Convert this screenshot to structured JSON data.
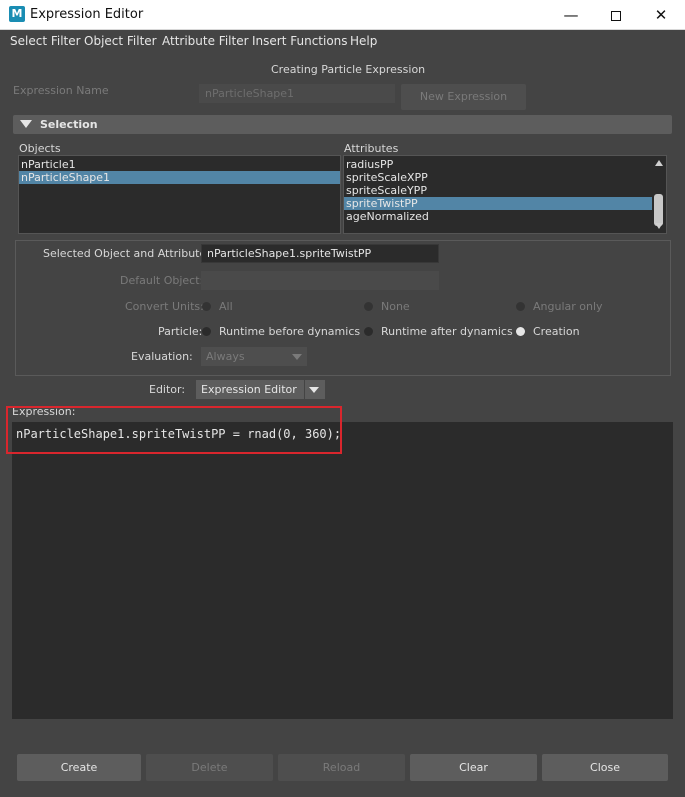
{
  "window": {
    "title": "Expression Editor",
    "icon_letter": "M",
    "controls": {
      "minimize": "—",
      "close": "✕"
    }
  },
  "menu": [
    "Select Filter",
    "Object Filter",
    "Attribute Filter",
    "Insert Functions",
    "Help"
  ],
  "header": {
    "mode": "Creating Particle Expression",
    "name_label": "Expression Name",
    "name_value": "nParticleShape1",
    "new_expression": "New Expression"
  },
  "selection": {
    "title": "Selection",
    "objects_label": "Objects",
    "attributes_label": "Attributes",
    "objects": [
      "nParticle1",
      "nParticleShape1"
    ],
    "objects_selected_index": 1,
    "attributes": [
      "radiusPP",
      "spriteScaleXPP",
      "spriteScaleYPP",
      "spriteTwistPP",
      "ageNormalized"
    ],
    "attributes_selected_index": 3
  },
  "options": {
    "selected_label": "Selected Object and Attribute:",
    "selected_value": "nParticleShape1.spriteTwistPP",
    "default_label": "Default Object:",
    "convert_label": "Convert Units:",
    "convert_options": [
      "All",
      "None",
      "Angular only"
    ],
    "particle_label": "Particle:",
    "particle_options": [
      "Runtime before dynamics",
      "Runtime after dynamics",
      "Creation"
    ],
    "particle_selected_index": 2,
    "evaluation_label": "Evaluation:",
    "evaluation_value": "Always",
    "editor_label": "Editor:",
    "editor_value": "Expression Editor"
  },
  "expression": {
    "label": "Expression:",
    "code": "nParticleShape1.spriteTwistPP = rnad(0, 360);"
  },
  "buttons": {
    "create": "Create",
    "delete": "Delete",
    "reload": "Reload",
    "clear": "Clear",
    "close": "Close"
  },
  "colors": {
    "selection_highlight": "#5285a6",
    "annotation_red": "#d9262d"
  }
}
